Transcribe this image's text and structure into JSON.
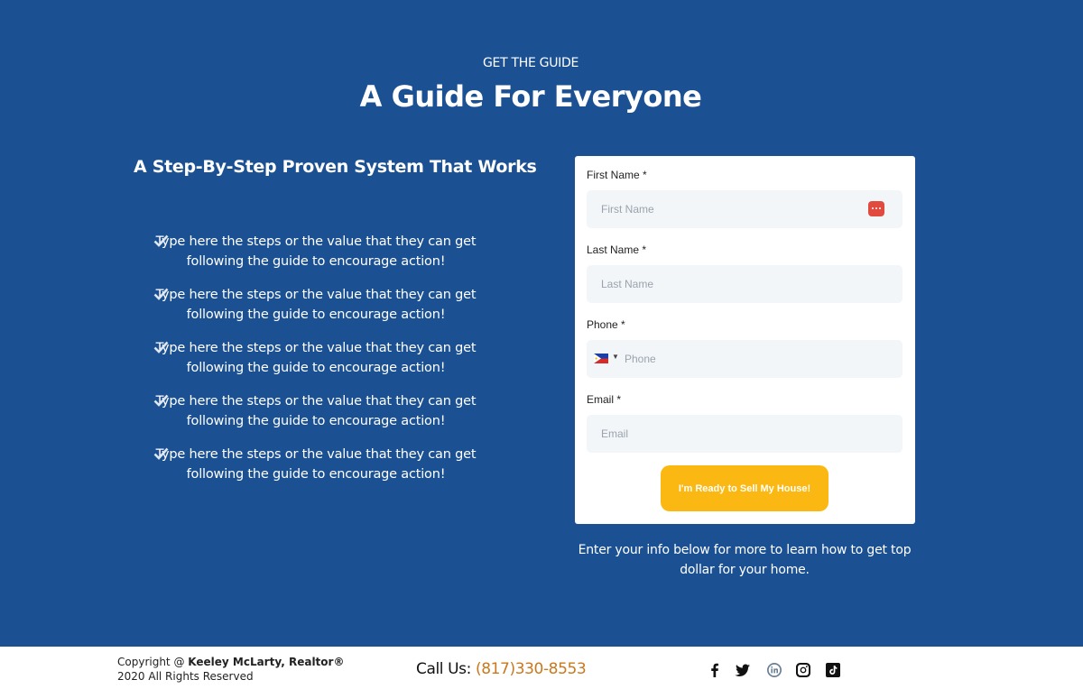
{
  "hero": {
    "eyebrow": "GET THE GUIDE",
    "title": "A Guide For Everyone",
    "subtitle": "A Step-By-Step Proven System That Works",
    "steps": [
      {
        "line1": "Type here the steps or the value that they can get",
        "line2": "following the guide to encourage action!"
      },
      {
        "line1": "Type here the steps or the value that they can get",
        "line2": "following the guide to encourage action!"
      },
      {
        "line1": "Type here the steps or the value that they can get",
        "line2": "following the guide to encourage action!"
      },
      {
        "line1": "Type here the steps or the value that they can get",
        "line2": "following the guide to encourage action!"
      },
      {
        "line1": "Type here the steps or the value that they can get",
        "line2": "following the guide to encourage action!"
      }
    ]
  },
  "form": {
    "first_name": {
      "label": "First Name *",
      "placeholder": "First Name"
    },
    "last_name": {
      "label": "Last Name *",
      "placeholder": "Last Name"
    },
    "phone": {
      "label": "Phone *",
      "placeholder": "Phone",
      "flag_icon": "philippines-flag-icon"
    },
    "email": {
      "label": "Email *",
      "placeholder": "Email"
    },
    "submit_label": "I'm Ready to Sell My House!",
    "note_line1": "Enter your info below for more to learn how to get top",
    "note_line2": "dollar for your home."
  },
  "footer": {
    "copyright_prefix": "Copyright @ ",
    "copyright_owner": "Keeley McLarty, Realtor®",
    "copyright_line2": "2020 All Rights Reserved",
    "call_label": "Call Us: ",
    "call_number": "(817)330-8553",
    "social_icons": [
      "facebook-icon",
      "twitter-icon",
      "linkedin-icon",
      "instagram-icon",
      "tiktok-icon"
    ]
  },
  "colors": {
    "hero_bg": "#1b5193",
    "button": "#fbb812",
    "phone_accent": "#c9781c",
    "field_bg": "#f3f6f9"
  }
}
